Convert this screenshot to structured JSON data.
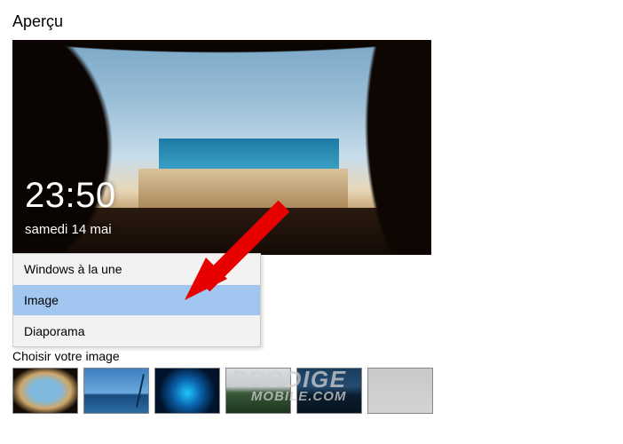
{
  "section_title": "Aperçu",
  "lockscreen": {
    "time": "23:50",
    "date": "samedi 14 mai"
  },
  "background_dropdown": {
    "options": [
      {
        "label": "Windows à la une",
        "selected": false
      },
      {
        "label": "Image",
        "selected": true
      },
      {
        "label": "Diaporama",
        "selected": false
      }
    ]
  },
  "choose_image_label": "Choisir votre image",
  "thumbnails": [
    {
      "name": "cave-beach"
    },
    {
      "name": "sea-pole"
    },
    {
      "name": "ice-cave"
    },
    {
      "name": "mountain-mist"
    },
    {
      "name": "dark-hill"
    },
    {
      "name": "gray-blank"
    }
  ],
  "watermark": {
    "line1": "PRODIGE",
    "line2": "MOBILE.COM"
  }
}
